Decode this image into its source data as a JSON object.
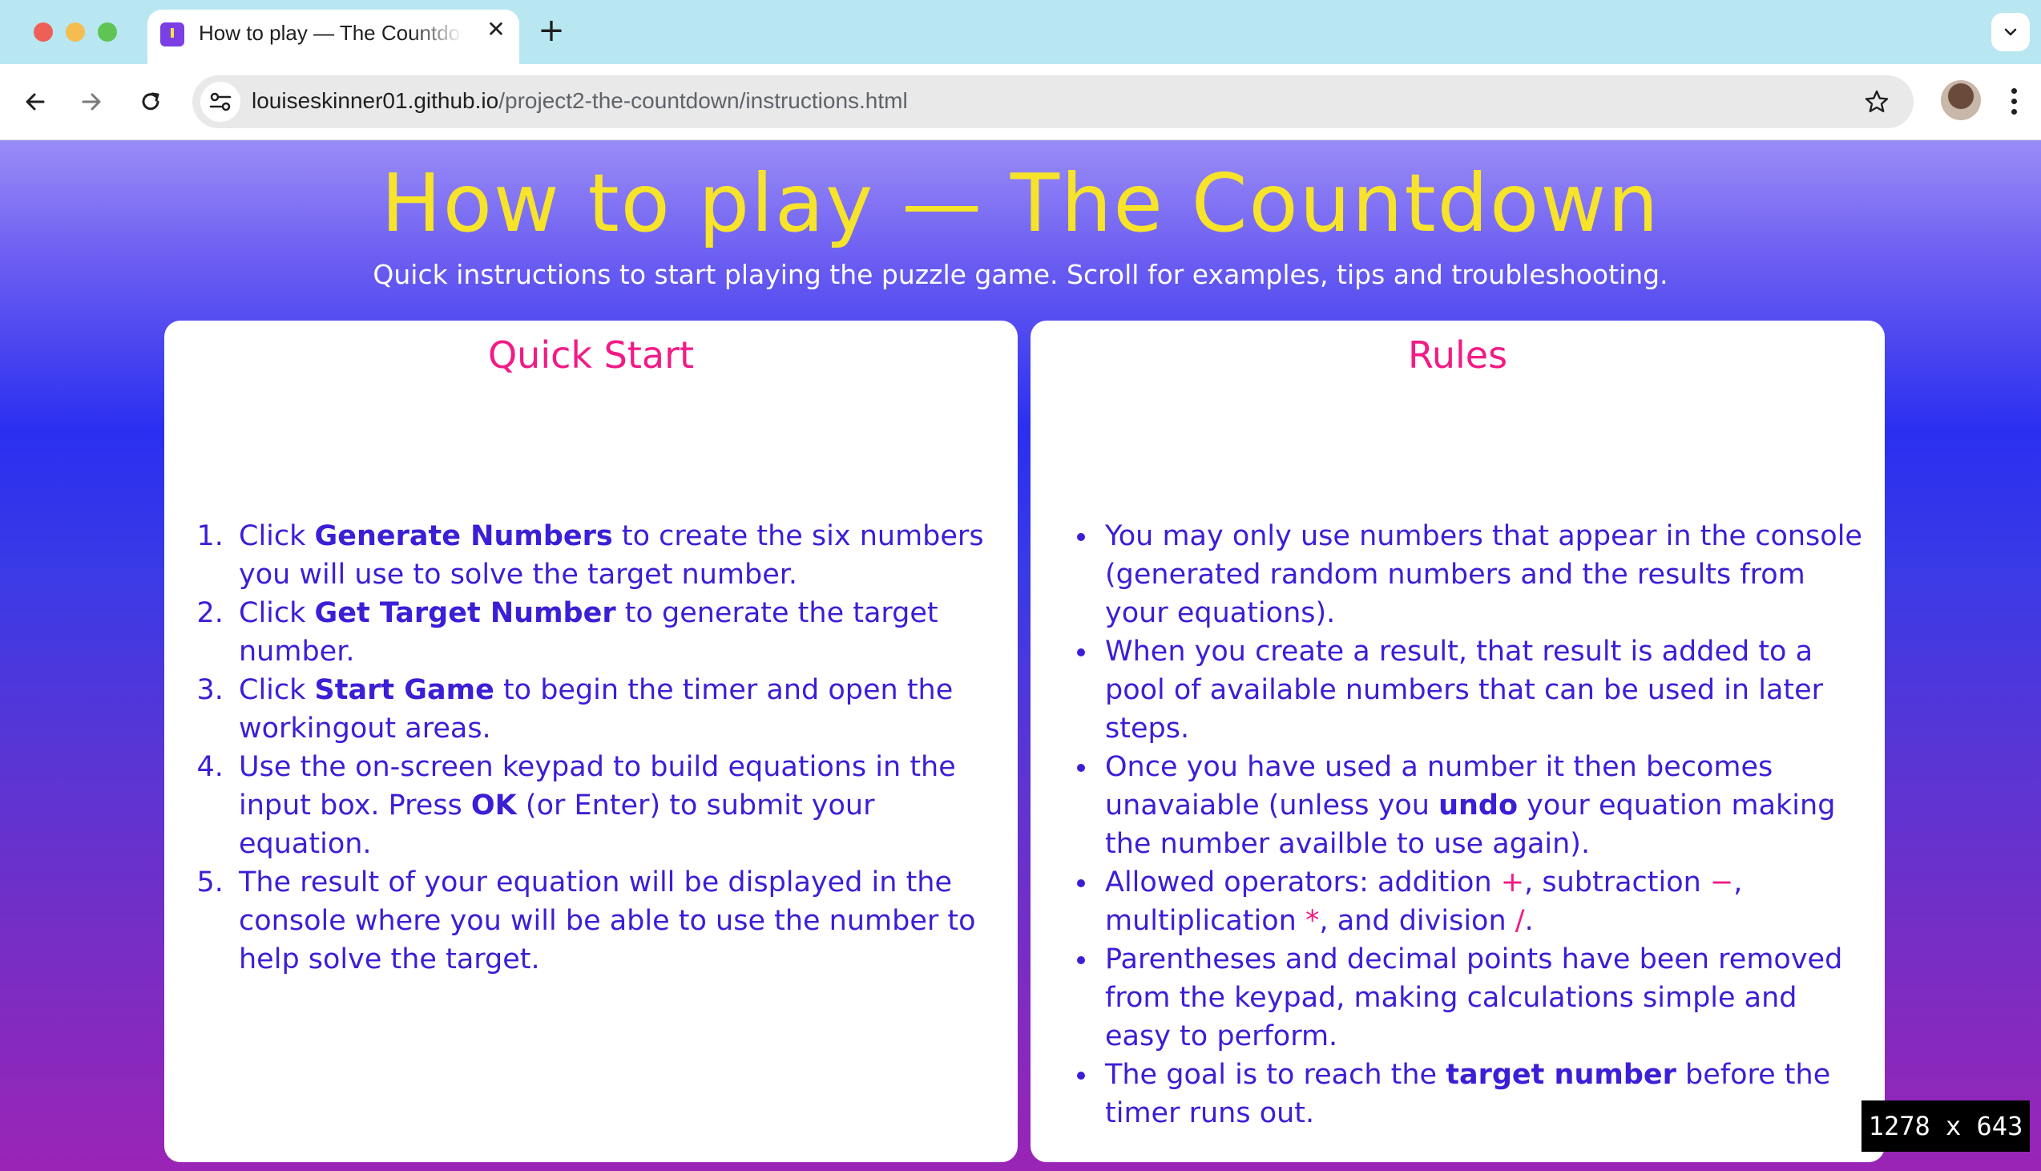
{
  "browser": {
    "tab_title": "How to play — The Countdown",
    "tab_close": "✕",
    "new_tab": "+",
    "url_host": "louiseskinner01.github.io",
    "url_path": "/project2-the-countdown/instructions.html"
  },
  "page": {
    "title": "How to play — The Countdown",
    "subtitle": "Quick instructions to start playing the puzzle game. Scroll for examples, tips and troubleshooting."
  },
  "quick_start": {
    "heading": "Quick Start",
    "steps": [
      {
        "pre": "Click ",
        "bold": "Generate Numbers",
        "post": " to create the six numbers you will use to solve the target number."
      },
      {
        "pre": "Click ",
        "bold": "Get Target Number",
        "post": " to generate the target number."
      },
      {
        "pre": "Click ",
        "bold": "Start Game",
        "post": " to begin the timer and open the workingout areas."
      },
      {
        "pre": "Use the on-screen keypad to build equations in the input box. Press ",
        "bold": "OK",
        "post": " (or Enter) to submit your equation."
      },
      {
        "pre": "The result of your equation will be displayed in the console where you will be able to use the number to help solve the target.",
        "bold": "",
        "post": ""
      }
    ]
  },
  "rules": {
    "heading": "Rules",
    "items": {
      "r1": "You may only use numbers that appear in the console (generated random numbers and the results from your equations).",
      "r2": "When you create a result, that result is added to a pool of available numbers that can be used in later steps.",
      "r3_pre": "Once you have used a number it then becomes unavaiable (unless you ",
      "r3_bold": "undo",
      "r3_post": " your equation making the number availble to use again).",
      "r4_a": "Allowed operators: addition ",
      "r4_plus": "+",
      "r4_b": ", subtraction ",
      "r4_minus": "−",
      "r4_c": ", multiplication ",
      "r4_mult": "*",
      "r4_d": ", and division ",
      "r4_div": "/",
      "r4_e": ".",
      "r5": "Parentheses and decimal points have been removed from the keypad, making calculations simple and easy to perform.",
      "r6_pre": "The goal is to reach the ",
      "r6_bold": "target number",
      "r6_post": " before the timer runs out."
    }
  },
  "overlay": {
    "size_badge": "1278 x 643"
  },
  "colors": {
    "title": "#f7e42a",
    "card_heading": "#f21b86",
    "body_text": "#3a1fd6"
  }
}
